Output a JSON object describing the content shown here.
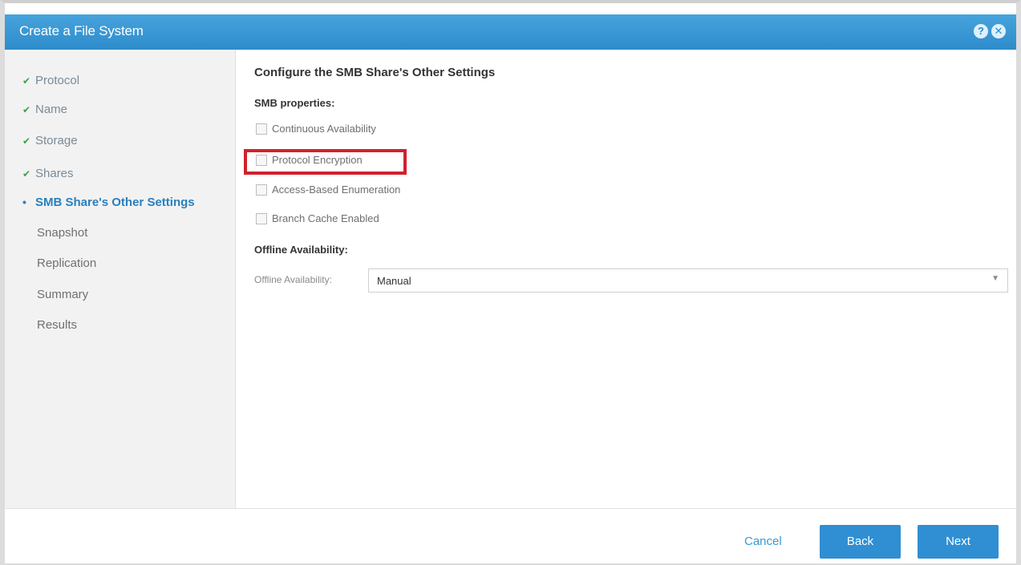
{
  "window": {
    "title": "Create a File System",
    "help_icon": "?",
    "close_icon": "✕"
  },
  "sidebar": {
    "steps": [
      {
        "label": "Protocol",
        "state": "done",
        "mark": "✔"
      },
      {
        "label": "Name",
        "state": "done",
        "mark": "✔"
      },
      {
        "label": "Storage",
        "state": "done",
        "mark": "✔"
      },
      {
        "label": "Shares",
        "state": "done",
        "mark": "✔"
      },
      {
        "label": "SMB Share's Other Settings",
        "state": "current",
        "mark": "•"
      },
      {
        "label": "Snapshot",
        "state": "pending"
      },
      {
        "label": "Replication",
        "state": "pending"
      },
      {
        "label": "Summary",
        "state": "pending"
      },
      {
        "label": "Results",
        "state": "pending"
      }
    ]
  },
  "main": {
    "heading": "Configure the SMB Share's Other Settings",
    "smb_properties_label": "SMB properties:",
    "checkboxes": [
      {
        "label": "Continuous Availability",
        "checked": false
      },
      {
        "label": "Protocol Encryption",
        "checked": false,
        "highlighted": true
      },
      {
        "label": "Access-Based Enumeration",
        "checked": false
      },
      {
        "label": "Branch Cache Enabled",
        "checked": false
      }
    ],
    "offline_section_label": "Offline Availability:",
    "offline_field_label": "Offline Availability:",
    "offline_value": "Manual"
  },
  "footer": {
    "cancel_label": "Cancel",
    "back_label": "Back",
    "next_label": "Next"
  },
  "colors": {
    "title_bar": "#3a97d3",
    "highlight": "#d0222c",
    "button": "#2f8fd2",
    "check_done": "#3aa24a"
  }
}
